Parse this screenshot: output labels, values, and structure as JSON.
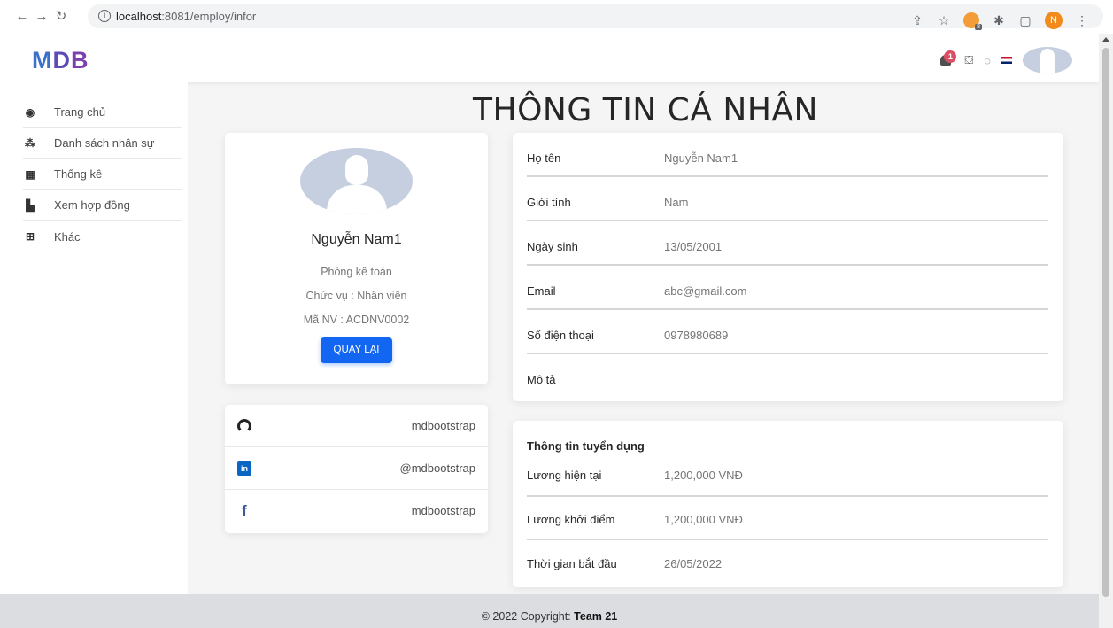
{
  "browser": {
    "url_host": "localhost",
    "url_rest": ":8081/employ/infor"
  },
  "brand": {
    "m": "M",
    "d": "D",
    "b": "B"
  },
  "notifications": {
    "count": "1"
  },
  "sidebar": {
    "items": [
      {
        "label": "Trang chủ",
        "icon": "dashboard-icon"
      },
      {
        "label": "Danh sách nhân sự",
        "icon": "users-icon"
      },
      {
        "label": "Thống kê",
        "icon": "calendar-icon"
      },
      {
        "label": "Xem hợp đồng",
        "icon": "file-icon"
      },
      {
        "label": "Khác",
        "icon": "grid-icon"
      }
    ]
  },
  "page": {
    "title": "THÔNG TIN CÁ NHÂN"
  },
  "profile": {
    "name": "Nguyễn Nam1",
    "department": "Phòng kế toán",
    "position": "Chức vụ : Nhân viên",
    "employee_id": "Mã NV : ACDNV0002",
    "back_button": "QUAY LẠI"
  },
  "social": [
    {
      "icon": "github-icon",
      "text": "mdbootstrap"
    },
    {
      "icon": "linkedin-icon",
      "text": "@mdbootstrap"
    },
    {
      "icon": "facebook-icon",
      "text": "mdbootstrap"
    }
  ],
  "info": {
    "rows": [
      {
        "label": "Họ tên",
        "value": "Nguyễn Nam1"
      },
      {
        "label": "Giới tính",
        "value": "Nam"
      },
      {
        "label": "Ngày sinh",
        "value": "13/05/2001"
      },
      {
        "label": "Email",
        "value": "abc@gmail.com"
      },
      {
        "label": "Số điện thoại",
        "value": "0978980689"
      },
      {
        "label": "Mô tả",
        "value": ""
      }
    ]
  },
  "recruitment": {
    "title": "Thông tin tuyển dụng",
    "rows": [
      {
        "label": "Lương hiện tại",
        "value": "1,200,000 VNĐ"
      },
      {
        "label": "Lương khởi điểm",
        "value": "1,200,000 VNĐ"
      },
      {
        "label": "Thời gian bắt đầu",
        "value": "26/05/2022"
      }
    ]
  },
  "footer": {
    "prefix": "© 2022 Copyright: ",
    "team": "Team 21"
  }
}
